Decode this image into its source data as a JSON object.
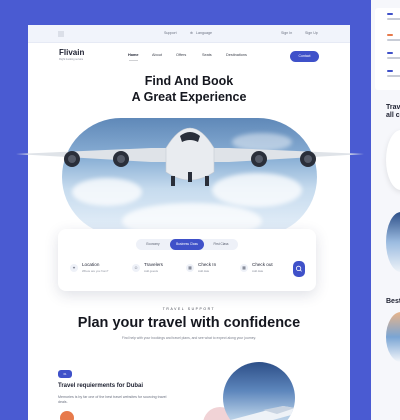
{
  "topbar": {
    "links": [
      "Support",
      "Language"
    ],
    "auth": [
      "Sign In",
      "Sign Up"
    ]
  },
  "brand": {
    "name": "Flivain",
    "tagline": "Flight booking service"
  },
  "nav": {
    "items": [
      "Home",
      "About",
      "Offers",
      "Seats",
      "Destinations"
    ],
    "active": "Home",
    "contact_label": "Contact"
  },
  "hero": {
    "title_line1": "Find And Book",
    "title_line2": "A Great Experience"
  },
  "search": {
    "tabs": [
      "Economy",
      "Business Class",
      "First Class"
    ],
    "active_tab": "Business Class",
    "fields": [
      {
        "label": "Location",
        "sub": "Where are you from?",
        "icon": "pin-icon"
      },
      {
        "label": "Travelers",
        "sub": "Add guests",
        "icon": "user-icon"
      },
      {
        "label": "Check In",
        "sub": "Add date",
        "icon": "calendar-icon"
      },
      {
        "label": "Check out",
        "sub": "Add date",
        "icon": "calendar-icon"
      }
    ]
  },
  "support": {
    "eyebrow": "TRAVEL SUPPORT",
    "title": "Plan your travel with confidence",
    "subtitle": "Find help with your bookings and travel plans, and see what to expect along your journey."
  },
  "card": {
    "badge": "01",
    "title": "Travel requierments for Dubai",
    "text": "Memories is by far one of the best travel websites for sourcing travel deals."
  },
  "mobile": {
    "heading1": "Trav all c",
    "heading2": "Best"
  },
  "colors": {
    "accent": "#3f51c9",
    "background": "#4a5bd2"
  }
}
